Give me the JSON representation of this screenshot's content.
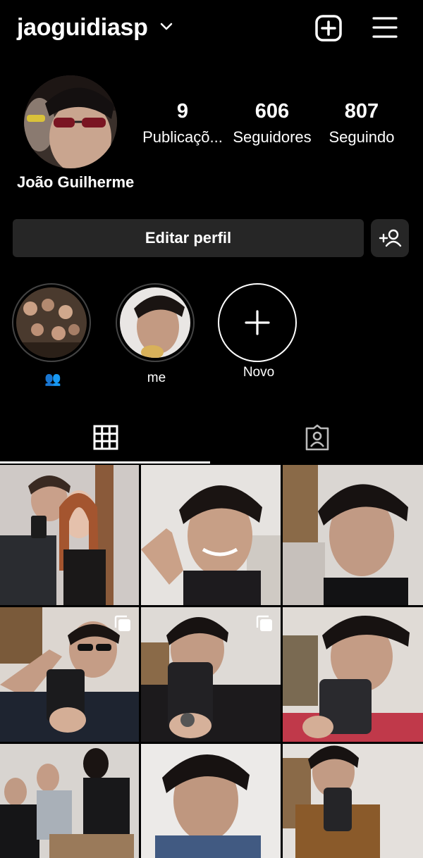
{
  "header": {
    "username": "jaoguidiasp",
    "icons": [
      "chevron-down-icon",
      "new-post-icon",
      "hamburger-menu-icon"
    ]
  },
  "profile": {
    "display_name": "João Guilherme",
    "stats": [
      {
        "value": "9",
        "label": "Publicaçõ..."
      },
      {
        "value": "606",
        "label": "Seguidores"
      },
      {
        "value": "807",
        "label": "Seguindo"
      }
    ]
  },
  "actions": {
    "edit_profile": "Editar perfil",
    "discover_people_icon": "add-person-icon"
  },
  "highlights": [
    {
      "label": "👥"
    },
    {
      "label": "me"
    },
    {
      "label": "Novo"
    }
  ],
  "tabs": [
    {
      "icon": "grid-icon",
      "active": true
    },
    {
      "icon": "tagged-icon",
      "active": false
    }
  ],
  "posts": [
    {
      "multi": false
    },
    {
      "multi": false
    },
    {
      "multi": false
    },
    {
      "multi": true
    },
    {
      "multi": true
    },
    {
      "multi": false
    },
    {
      "multi": false
    },
    {
      "multi": false
    },
    {
      "multi": false
    }
  ],
  "colors": {
    "background": "#000000",
    "button": "#262626",
    "text": "#ffffff"
  }
}
